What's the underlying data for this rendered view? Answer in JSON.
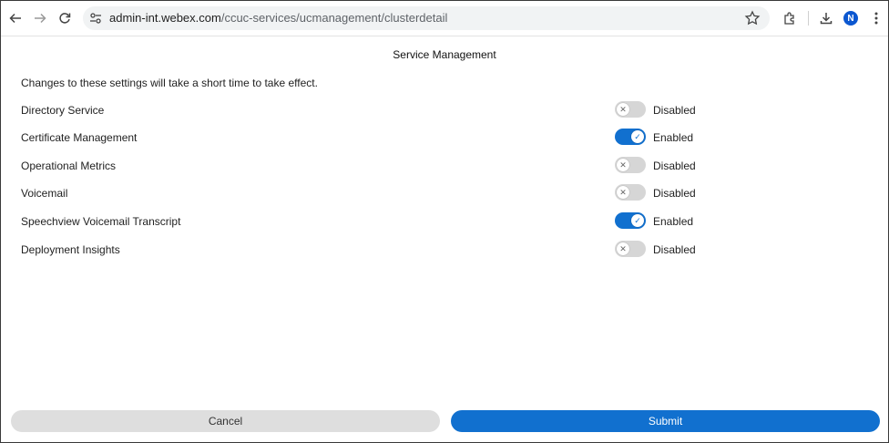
{
  "browser": {
    "url_host": "admin-int.webex.com",
    "url_path": "/ccuc-services/ucmanagement/clusterdetail",
    "profile_initial": "N",
    "icons": [
      "back-icon",
      "forward-icon",
      "reload-icon",
      "site-info-icon",
      "star-icon",
      "extensions-icon",
      "download-icon",
      "more-vert-icon"
    ]
  },
  "page": {
    "title": "Service Management",
    "intro": "Changes to these settings will take a short time to take effect."
  },
  "services": [
    {
      "label": "Directory Service",
      "enabled": false,
      "state": "Disabled"
    },
    {
      "label": "Certificate Management",
      "enabled": true,
      "state": "Enabled"
    },
    {
      "label": "Operational Metrics",
      "enabled": false,
      "state": "Disabled"
    },
    {
      "label": "Voicemail",
      "enabled": false,
      "state": "Disabled"
    },
    {
      "label": "Speechview Voicemail Transcript",
      "enabled": true,
      "state": "Enabled"
    },
    {
      "label": "Deployment Insights",
      "enabled": false,
      "state": "Disabled"
    }
  ],
  "footer": {
    "cancel_label": "Cancel",
    "submit_label": "Submit"
  },
  "colors": {
    "accent": "#1170cf",
    "toggle_off": "#d6d6d6",
    "cancel_bg": "#dedede"
  }
}
